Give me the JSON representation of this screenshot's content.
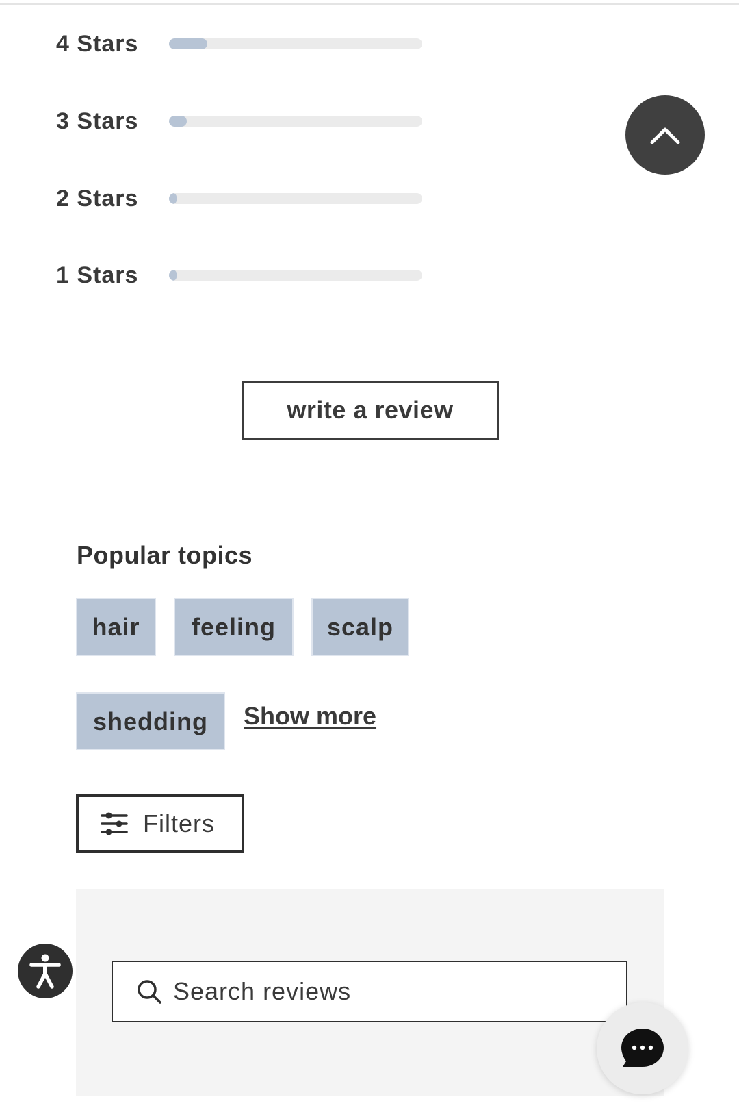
{
  "ratings": [
    {
      "label": "4 Stars",
      "fraction": 0.15
    },
    {
      "label": "3 Stars",
      "fraction": 0.07
    },
    {
      "label": "2 Stars",
      "fraction": 0.03
    },
    {
      "label": "1 Stars",
      "fraction": 0.03
    }
  ],
  "write_review": {
    "label": "write a review"
  },
  "topics": {
    "title": "Popular topics",
    "chips": [
      "hair",
      "feeling",
      "scalp",
      "shedding"
    ],
    "show_more": "Show more"
  },
  "filters": {
    "label": "Filters"
  },
  "search": {
    "placeholder": "Search reviews"
  },
  "colors": {
    "rating_fill": "#b7c4d5",
    "rating_track": "#ebebeb",
    "chip_bg": "#b7c4d5",
    "dark_button": "#404040",
    "panel_bg": "#f4f4f4"
  },
  "icons": {
    "back_to_top": "chevron-up-icon",
    "filters": "sliders-icon",
    "search": "search-icon",
    "accessibility": "accessibility-icon",
    "chat": "chat-bubble-icon"
  }
}
